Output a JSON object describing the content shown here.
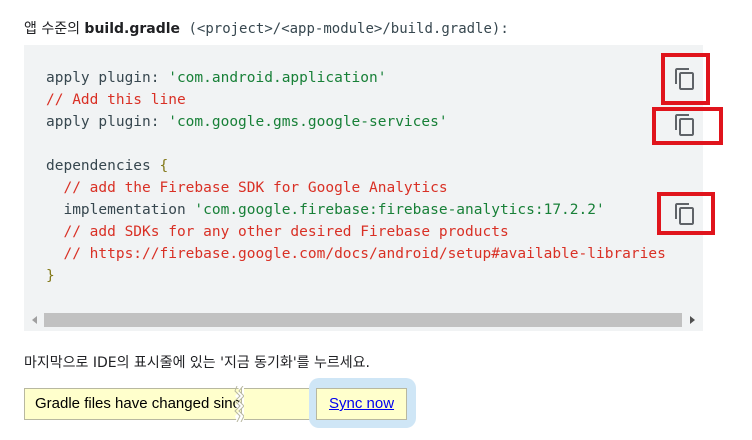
{
  "intro": {
    "prefix": "앱 수준의 ",
    "filename": "build.gradle",
    "path": " (<project>/<app-module>/build.gradle):"
  },
  "code": {
    "lines": [
      {
        "parts": [
          {
            "t": "apply plugin: ",
            "k": "plain"
          },
          {
            "t": "'com.android.application'",
            "k": "str"
          }
        ]
      },
      {
        "parts": [
          {
            "t": "// Add this line",
            "k": "com"
          }
        ]
      },
      {
        "parts": [
          {
            "t": "apply plugin: ",
            "k": "plain"
          },
          {
            "t": "'com.google.gms.google-services'",
            "k": "str"
          }
        ]
      },
      {
        "parts": []
      },
      {
        "parts": [
          {
            "t": "dependencies ",
            "k": "plain"
          },
          {
            "t": "{",
            "k": "brace"
          }
        ]
      },
      {
        "parts": [
          {
            "t": "  // add the Firebase SDK for Google Analytics",
            "k": "com"
          }
        ]
      },
      {
        "parts": [
          {
            "t": "  implementation ",
            "k": "plain"
          },
          {
            "t": "'com.google.firebase:firebase-analytics:17.2.2'",
            "k": "str"
          }
        ]
      },
      {
        "parts": [
          {
            "t": "  // add SDKs for any other desired Firebase products",
            "k": "com"
          }
        ]
      },
      {
        "parts": [
          {
            "t": "  // https://firebase.google.com/docs/android/setup#available-libraries",
            "k": "com"
          }
        ]
      },
      {
        "parts": [
          {
            "t": "}",
            "k": "brace"
          }
        ]
      }
    ]
  },
  "icons": {
    "copy": "copy-icon"
  },
  "colors": {
    "string": "#188038",
    "comment": "#d93025",
    "highlight": "#e0141c",
    "notification_bg": "#ffffcc",
    "link": "#0000ee"
  },
  "outro": {
    "text": "마지막으로 IDE의 표시줄에 있는 '지금 동기화'를 누르세요."
  },
  "notification": {
    "message": "Gradle files have changed since last project sync",
    "action_label": "Sync now"
  }
}
